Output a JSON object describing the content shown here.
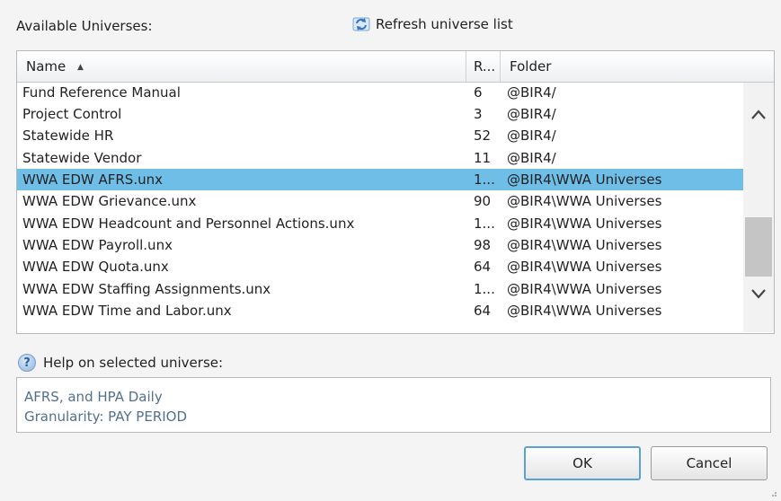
{
  "dialog": {
    "available_label": "Available Universes:",
    "refresh_label": "Refresh universe list",
    "columns": {
      "name": "Name",
      "r": "R...",
      "folder": "Folder"
    },
    "rows": [
      {
        "name": "Fund Reference Manual",
        "r": "6",
        "folder": "@BIR4/",
        "selected": false
      },
      {
        "name": "Project Control",
        "r": "3",
        "folder": "@BIR4/",
        "selected": false
      },
      {
        "name": "Statewide HR",
        "r": "52",
        "folder": "@BIR4/",
        "selected": false
      },
      {
        "name": "Statewide Vendor",
        "r": "11",
        "folder": "@BIR4/",
        "selected": false
      },
      {
        "name": "WWA EDW AFRS.unx",
        "r": "1...",
        "folder": "@BIR4\\WWA Universes",
        "selected": true
      },
      {
        "name": "WWA EDW Grievance.unx",
        "r": "90",
        "folder": "@BIR4\\WWA Universes",
        "selected": false
      },
      {
        "name": "WWA EDW Headcount and Personnel Actions.unx",
        "r": "1...",
        "folder": "@BIR4\\WWA Universes",
        "selected": false
      },
      {
        "name": "WWA EDW Payroll.unx",
        "r": "98",
        "folder": "@BIR4\\WWA Universes",
        "selected": false
      },
      {
        "name": "WWA EDW Quota.unx",
        "r": "64",
        "folder": "@BIR4\\WWA Universes",
        "selected": false
      },
      {
        "name": "WWA EDW Staffing Assignments.unx",
        "r": "1...",
        "folder": "@BIR4\\WWA Universes",
        "selected": false
      },
      {
        "name": "WWA EDW Time and Labor.unx",
        "r": "64",
        "folder": "@BIR4\\WWA Universes",
        "selected": false
      }
    ],
    "help_label": "Help on selected universe:",
    "help_lines": [
      "AFRS, and HPA Daily",
      "Granularity: PAY PERIOD"
    ],
    "ok_label": "OK",
    "cancel_label": "Cancel",
    "selection_color": "#6fbee7",
    "help_text_color": "#51708f"
  }
}
